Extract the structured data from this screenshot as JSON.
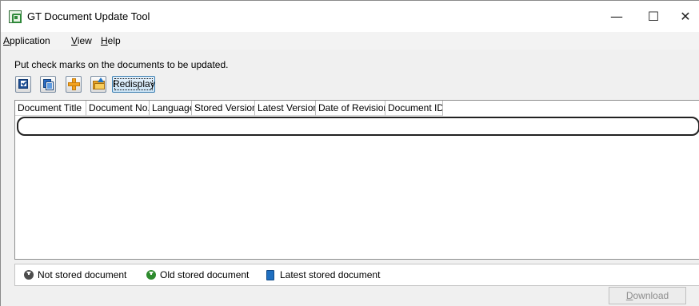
{
  "window": {
    "title": "GT Document Update Tool",
    "controls": {
      "minimize": "—",
      "maximize": "☐",
      "close": "✕"
    }
  },
  "menu": {
    "items": [
      {
        "mnemonic": "A",
        "rest": "pplication"
      },
      {
        "mnemonic": "V",
        "rest": "iew"
      },
      {
        "mnemonic": "H",
        "rest": "elp"
      }
    ]
  },
  "instruction": "Put check marks on the documents to be updated.",
  "toolbar": {
    "icons": [
      "check-all-icon",
      "copy-icon",
      "add-icon",
      "open-folder-icon"
    ],
    "redisplay_label": "Redisplay"
  },
  "grid": {
    "columns": [
      "Document Title",
      "Document No.",
      "Language",
      "Stored Version",
      "Latest Version",
      "Date of Revision",
      "Document ID"
    ],
    "rows": []
  },
  "legend": {
    "items": [
      {
        "icon": "not-stored-icon",
        "label": "Not stored document"
      },
      {
        "icon": "old-stored-icon",
        "label": "Old stored document"
      },
      {
        "icon": "latest-stored-icon",
        "label": "Latest stored document"
      }
    ]
  },
  "footer": {
    "download_mnemonic": "D",
    "download_rest": "ownload",
    "download_enabled": false
  }
}
